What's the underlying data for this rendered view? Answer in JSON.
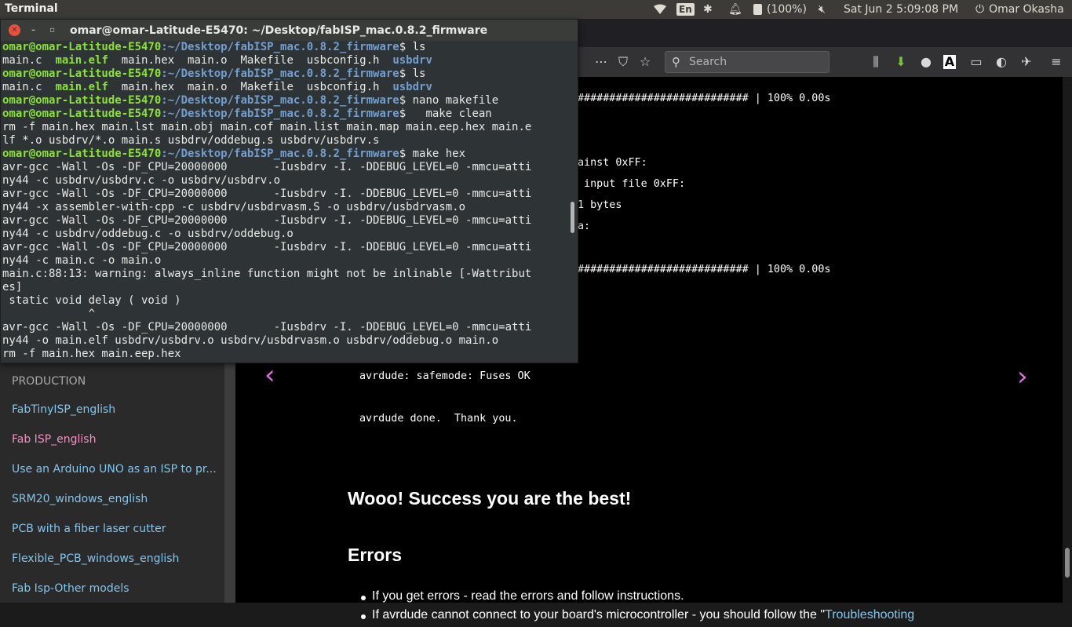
{
  "topbar": {
    "app_name": "Terminal",
    "keyboard_layout": "En",
    "battery": "(100%)",
    "datetime": "Sat Jun  2  5:09:08 PM",
    "user": "Omar Okasha"
  },
  "browser": {
    "search_placeholder": "Search",
    "sidebar_partial_item": "PRODUCTION",
    "sidebar_items": [
      {
        "label": "FabTinyISP_english",
        "visited": false
      },
      {
        "label": "Fab ISP_english",
        "visited": true
      },
      {
        "label": "Use an Arduino UNO as an ISP to pr...",
        "visited": false
      },
      {
        "label": "SRM20_windows_english",
        "visited": false
      },
      {
        "label": "PCB with a fiber laser cutter",
        "visited": false
      },
      {
        "label": "Flexible_PCB_windows_english",
        "visited": false
      },
      {
        "label": "Fab Isp-Other models",
        "visited": false
      }
    ],
    "content": {
      "progress_line_1": "########################### | 100% 0.00s",
      "verify_line_1": "ainst 0xFF:",
      "verify_line_2": " input file 0xFF:",
      "verify_line_3": "1 bytes",
      "verify_line_4": "a:",
      "progress_line_2": "########################### | 100% 0.00s",
      "fuses_ok": "avrdude: safemode: Fuses OK",
      "done": "avrdude done.  Thank you.",
      "success_heading": "Wooo! Success you are the best!",
      "errors_heading": "Errors",
      "bullet_1": "If you get errors - read the errors and follow instructions.",
      "bullet_2_prefix": "If avrdude cannot connect to your board's microcontroller - you should follow the \"",
      "bullet_2_link": "Troubleshooting"
    }
  },
  "terminal": {
    "title": "omar@omar-Latitude-E5470: ~/Desktop/fabISP_mac.0.8.2_firmware",
    "prompt_user": "omar@omar-Latitude-E5470",
    "prompt_path": ":~/Desktop/fabISP_mac.0.8.2_firmware",
    "lines": {
      "cmd_ls": "$ ls",
      "cmd_nano": "$ nano makefile",
      "cmd_clean": "$   make clean",
      "cmd_hex": "$ make hex",
      "ls_main_c": "main.c  ",
      "ls_main_elf": "main.elf",
      "ls_rest": "  main.hex  main.o  Makefile  usbconfig.h  ",
      "ls_usbdrv": "usbdrv",
      "clean_1": "rm -f main.hex main.lst main.obj main.cof main.list main.map main.eep.hex main.e",
      "clean_2": "lf *.o usbdrv/*.o main.s usbdrv/oddebug.s usbdrv/usbdrv.s",
      "gcc_a": "avr-gcc -Wall -Os -DF_CPU=20000000       -Iusbdrv -I. -DDEBUG_LEVEL=0 -mmcu=atti",
      "gcc_1b": "ny44 -c usbdrv/usbdrv.c -o usbdrv/usbdrv.o",
      "gcc_2b": "ny44 -x assembler-with-cpp -c usbdrv/usbdrvasm.S -o usbdrv/usbdrvasm.o",
      "gcc_3b": "ny44 -c usbdrv/oddebug.c -o usbdrv/oddebug.o",
      "gcc_4b": "ny44 -c main.c -o main.o",
      "warn_1": "main.c:88:13: warning: always_inline function might not be inlinable [-Wattribut",
      "warn_2": "es]",
      "warn_3": " static void delay ( void )",
      "warn_4": "             ^",
      "gcc_5b": "ny44 -o main.elf usbdrv/usbdrv.o usbdrv/usbdrvasm.o usbdrv/oddebug.o main.o",
      "rm_last": "rm -f main.hex main.eep.hex"
    }
  }
}
